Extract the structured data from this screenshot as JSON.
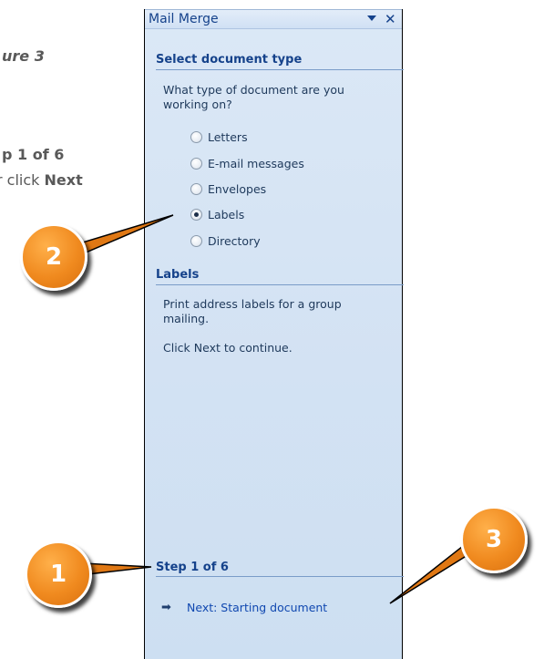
{
  "document": {
    "figure_label": "ure 3",
    "step_label": "p 1 of 6",
    "click_prefix": "r click ",
    "click_next": "Next"
  },
  "task_pane": {
    "title": "Mail Merge",
    "section_select": {
      "heading": "Select document type",
      "prompt_line1": "What type of document are you",
      "prompt_line2": "working on?",
      "options": [
        {
          "label": "Letters",
          "selected": false
        },
        {
          "label": "E-mail messages",
          "selected": false
        },
        {
          "label": "Envelopes",
          "selected": false
        },
        {
          "label": "Labels",
          "selected": true
        },
        {
          "label": "Directory",
          "selected": false
        }
      ]
    },
    "section_labels": {
      "heading": "Labels",
      "description_line1": "Print address labels for a group",
      "description_line2": "mailing.",
      "instruction": "Click Next to continue."
    },
    "footer": {
      "step": "Step 1 of 6",
      "next_link": "Next: Starting document"
    }
  },
  "callouts": {
    "one": "1",
    "two": "2",
    "three": "3"
  },
  "colors": {
    "pane_background": "#d6e4f4",
    "heading_text": "#15428b",
    "link_text": "#1048b0",
    "callout_orange": "#f08a1f"
  }
}
